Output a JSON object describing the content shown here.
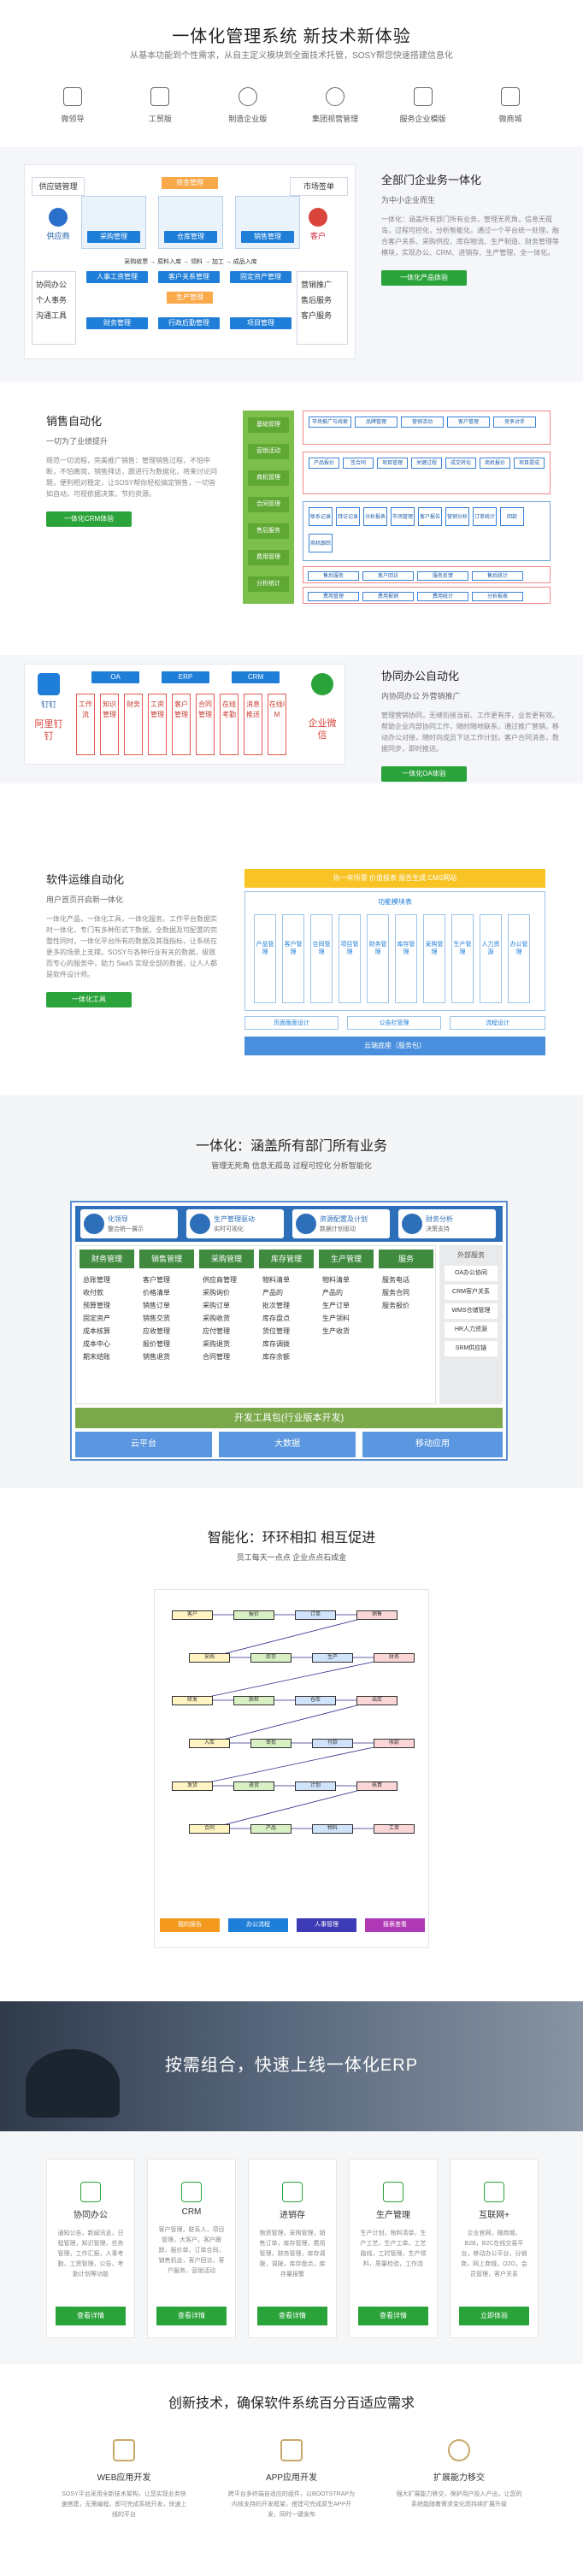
{
  "hero": {
    "title": "一体化管理系统 新技术新体验",
    "subtitle": "从基本功能到个性需求，从自主定义模块到全面技术托管，SOSY帮您快速搭建信息化"
  },
  "features": [
    {
      "label": "微领导"
    },
    {
      "label": "工贸版"
    },
    {
      "label": "制造企业版"
    },
    {
      "label": "集团视营管理"
    },
    {
      "label": "服务企业模版"
    },
    {
      "label": "微商城"
    }
  ],
  "sec1": {
    "title": "全部门企业务一体化",
    "subtitle": "为中小企业而生",
    "desc": "一体化：涵盖所有部门所有业务，管理无死角，信息无孤岛，过程可控化，分析智能化。通过一个平台统一处理，融合客户关系、采购供应、库存物流、生产制造、财务管理等模块，实现办公、CRM、进销存、生产管理、全一体化。",
    "button": "一体化产品体验",
    "diagram": {
      "supplier_mgmt": "供应链管理",
      "supplier": "供应商",
      "market_mgmt": "市场签单",
      "customer": "客户",
      "collab": [
        "协同办公",
        "个人事务",
        "沟通工具"
      ],
      "marketing": [
        "营销推广",
        "售后服务",
        "客户服务"
      ],
      "top_label": "资金管理",
      "flow": [
        "采购管理",
        "仓库管理",
        "销售管理"
      ],
      "flow_line": "采购收票 → 原料入库 → 领料 → 加工 → 成品入库",
      "mods": [
        "人事工资管理",
        "客户关系管理",
        "固定资产管理"
      ],
      "mods2": [
        "财务管理",
        "行政后勤管理",
        "项目管理"
      ],
      "mid": "生产管理"
    }
  },
  "sec2": {
    "title": "销售自动化",
    "subtitle": "一切为了业绩提升",
    "desc": "规范一切流程，完美推广销售：管理销售过程，不怕中断，不怕离岗，销售拜访，跟进行为数据化，将来讨论问题，便利相对稳定，让SOSY帮你轻松搞定销售，一切皆如自动，可视依据决策，节约资源。",
    "button": "一体化CRM体验",
    "left": [
      "基础管理",
      "营销活动",
      "商机管理",
      "合同管理",
      "售后服务",
      "费用管理",
      "分析统计"
    ],
    "row1": [
      "市场推广与线索",
      "品牌管理",
      "营销活动",
      "客户管理",
      "竞争对手"
    ],
    "row2": [
      "产品报价",
      "签合同",
      "项目管理",
      "关键过程",
      "成交转化",
      "商机报价",
      "项目提成"
    ],
    "row3": [
      "联系记录",
      "拜访记录",
      "分析报表",
      "市场管理",
      "客户报告",
      "营销分析",
      "订单统计",
      "回款",
      "商机跟踪"
    ],
    "row4": [
      "售后服务",
      "客户回访",
      "服务反馈",
      "售后统计"
    ],
    "row5": [
      "费用管理",
      "费用报销",
      "费用统计",
      "分析报表"
    ]
  },
  "sec3": {
    "title": "协同办公自动化",
    "subtitle": "内协同办公 外营销推广",
    "desc": "管理营销协同，无缝衔接当前、工作更有序，业务更有效。帮助企业内部协同工作，随时随地联系，通过推广营销，移动办公对接，随时向成员下达工作计划，客户合同消息，数据同步，即时推送。",
    "button": "一体化OA体验",
    "dd": "钉钉",
    "dd_label": "阿里钉钉",
    "wx_label": "企业微信",
    "tops": [
      "OA",
      "ERP",
      "CRM"
    ],
    "cols": [
      "工作流",
      "知识管理",
      "财务",
      "工资管理",
      "客户管理",
      "合同管理",
      "在线考勤",
      "消息推送",
      "在线IM"
    ]
  },
  "sec4": {
    "title": "软件运维自动化",
    "subtitle": "用户首页开启新一体化",
    "desc": "一体化产品，一体化工具，一体化服务。工作平台数据实时一体化，专门有多种形式下数据，全数据及可配置的完整性同时，一体化平台所有的数据及其强指标，让系统在更多的场景上支撑。SOSY与各种行业有关的数据，极致而专心的服务中，助力 SaaS 实现全部的数据，让人人都是软件设计师。",
    "button": "一体化工具",
    "top": "你一年所需  价值报表  报告生成  CMS网站",
    "func": "功能模块表",
    "cols": [
      "产品管理",
      "客户管理",
      "合同管理",
      "项目管理",
      "财务管理",
      "库存管理",
      "采购管理",
      "生产管理",
      "人力资源",
      "办公管理"
    ],
    "bars": [
      "页面版面设计",
      "公告栏管理",
      "流程设计"
    ],
    "bottom": "云端底座（服务包）"
  },
  "sec5": {
    "title": "一体化：涵盖所有部门所有业务",
    "subtitle": "管理无死角 信息无孤岛 过程可控化 分析智能化",
    "tops": [
      {
        "label": "化领导",
        "sub": "整合统一展示"
      },
      {
        "label": "生产管理驱动",
        "sub": "实时可视化"
      },
      {
        "label": "资源配置及计划",
        "sub": "数据计划驱动"
      },
      {
        "label": "财务分析",
        "sub": "决策支持"
      }
    ],
    "heads": [
      "财务管理",
      "销售管理",
      "采购管理",
      "库存管理",
      "生产管理",
      "服务"
    ],
    "cols": [
      [
        "总账管理",
        "收付款",
        "预算管理",
        "固定资产",
        "成本核算",
        "成本中心",
        "期末结账"
      ],
      [
        "客户管理",
        "价格清单",
        "销售订单",
        "销售交货",
        "应收管理",
        "报价管理",
        "销售退货"
      ],
      [
        "供应商管理",
        "采购询价",
        "采购订单",
        "采购收货",
        "应付管理",
        "采购退货",
        "合同管理"
      ],
      [
        "物料清单",
        "产品的",
        "批次管理",
        "库存盘点",
        "货位管理",
        "库存调拨",
        "库存余额"
      ],
      [
        "物料清单",
        "产品的",
        "生产订单",
        "生产领料",
        "生产收货"
      ],
      [
        "服务电话",
        "服务合同",
        "服务报价"
      ]
    ],
    "side_head": "外部服务",
    "side": [
      "OA办公协同",
      "CRM客户关系",
      "WMS仓储管理",
      "HR人力资源",
      "SRM供应链"
    ],
    "bar": "开发工具包(行业版本开发)",
    "bottom": [
      "云平台",
      "大数据",
      "移动应用"
    ]
  },
  "sec6": {
    "title": "智能化：环环相扣 相互促进",
    "subtitle": "员工每天一点点 企业点点石成金",
    "legend": [
      "我的报告",
      "办公流程",
      "人事管理",
      "报表查看"
    ],
    "nodes": [
      "客户",
      "报价",
      "订单",
      "销售",
      "采购",
      "库存",
      "生产",
      "财务",
      "研发",
      "质检",
      "仓库",
      "出库",
      "入库",
      "审批",
      "付款",
      "收款",
      "发货",
      "退货",
      "计划",
      "核算",
      "合同",
      "产品",
      "物料",
      "工单"
    ]
  },
  "sec7": {
    "title": "按需组合，快速上线一体化ERP"
  },
  "modules": [
    {
      "title": "协同办公",
      "desc": "通知公告，新闻讯息，日程管理，知识管理，任务管理，工作汇报，人事考勤，工资管理，公告，考勤计划等功能",
      "button": "查看详情"
    },
    {
      "title": "CRM",
      "desc": "客户管理，联系人，项目管理，大客户，客户跟踪，报价单，订单合同，销售机会，客户回访，客户服务，营销活动",
      "button": "查看详情"
    },
    {
      "title": "进销存",
      "desc": "物资管理，采购管理，销售订单，库存管理，费用管理，财务管理，库存调拨，调拨，库存盘点，库存量报警",
      "button": "查看详情"
    },
    {
      "title": "生产管理",
      "desc": "生产计划，物料清单，生产工艺，生产工单，工艺路线，工时管理，生产领料，质量检验，工作流",
      "button": "查看详情"
    },
    {
      "title": "互联网+",
      "desc": "企业官网，微商城，B2B，B2C在线交易平台，移动办公平台，分销商，网上商城，O2O，会员管理，客户关系",
      "button": "立即体验"
    }
  ],
  "sec8": {
    "title": "创新技术，确保软件系统百分百适应需求",
    "items": [
      {
        "title": "WEB应用开发",
        "desc": "SOSY平台采用全新技术架构，让您实现业务快速搭建，无需编程、即可完成系统开发，快速上线的平台"
      },
      {
        "title": "APP应用开发",
        "desc": "跨平台多终端自适应的组件，以BOOTSTRAP为内核支持的开发框架，搭建可完成原生APP开发，同时一键发布"
      },
      {
        "title": "扩展能力移交",
        "desc": "强大扩展能力移交，保护用户投入产出，让您的系统能随着需求变化而持续扩展升级"
      }
    ]
  },
  "colors": {
    "green": "#2aa33a",
    "blue": "#1e7ed8",
    "orange": "#f9a84a"
  }
}
